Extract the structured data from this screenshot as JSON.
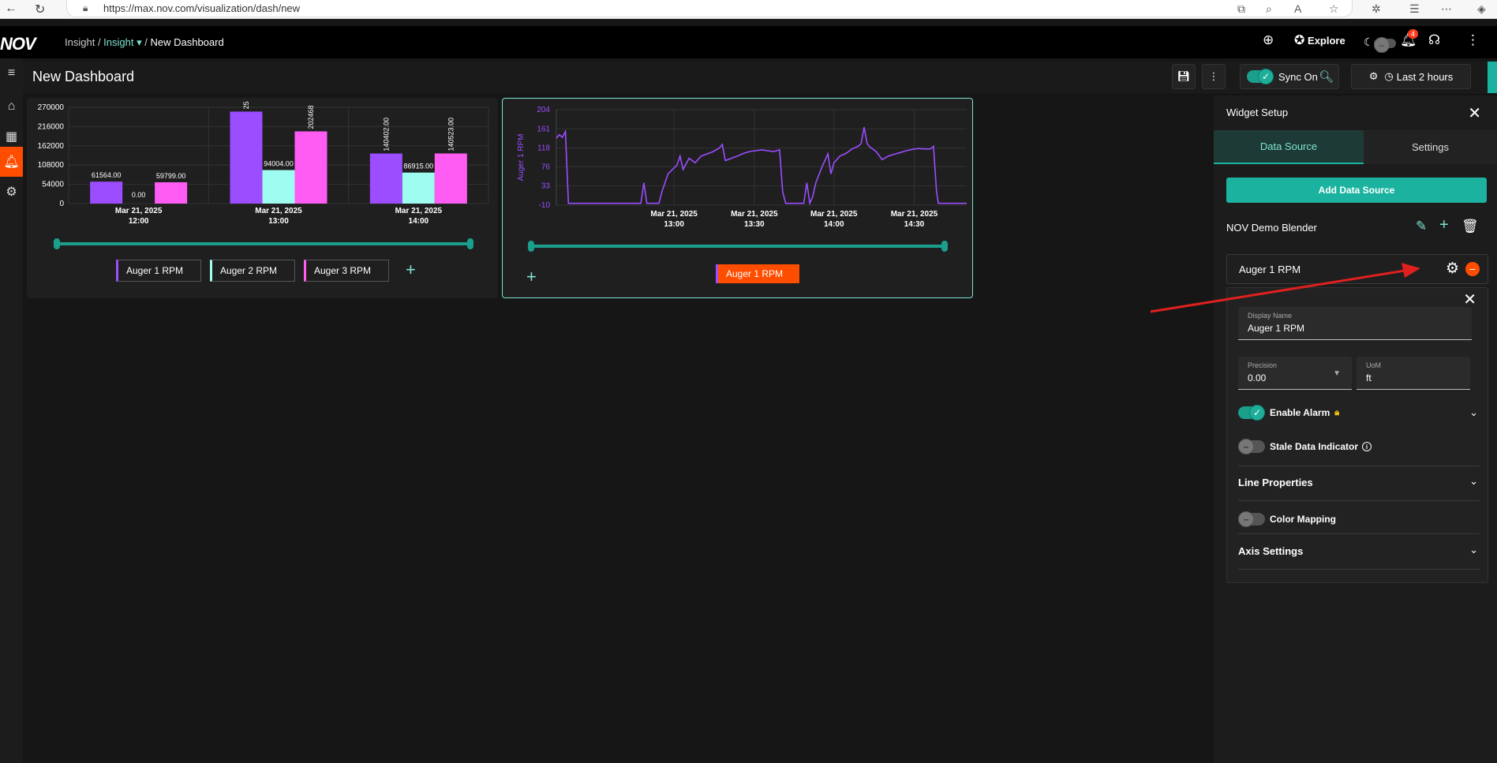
{
  "browser": {
    "url": "https://max.nov.com/visualization/dash/new"
  },
  "header": {
    "logo": "NOV",
    "breadcrumb": {
      "root": "Insight",
      "section": "Insight",
      "page": "New Dashboard"
    },
    "explore_label": "Explore",
    "notification_count": "4"
  },
  "toolbar": {
    "title": "New Dashboard",
    "sync_label": "Sync On",
    "time_range_label": "Last 2 hours"
  },
  "bar_widget": {
    "legend": [
      {
        "label": "Auger 1 RPM",
        "color": "#9b4dff"
      },
      {
        "label": "Auger 2 RPM",
        "color": "#9efcf0"
      },
      {
        "label": "Auger 3 RPM",
        "color": "#ff5cf4"
      }
    ]
  },
  "line_widget": {
    "legend": [
      {
        "label": "Auger 1 RPM",
        "color": "#ff4d00"
      }
    ]
  },
  "chart_data": [
    {
      "type": "bar",
      "categories": [
        "Mar 21, 2025 12:00",
        "Mar 21, 2025 13:00",
        "Mar 21, 2025 14:00"
      ],
      "category_lines": [
        [
          "Mar 21, 2025",
          "12:00"
        ],
        [
          "Mar 21, 2025",
          "13:00"
        ],
        [
          "Mar 21, 2025",
          "14:00"
        ]
      ],
      "y_ticks": [
        "270000",
        "216000",
        "162000",
        "108000",
        "54000",
        "0"
      ],
      "ylim": [
        0,
        270000
      ],
      "series": [
        {
          "name": "Auger 1 RPM",
          "color": "#9b4dff",
          "values": [
            61564,
            258000,
            140402
          ],
          "labels": [
            "61564.00",
            "25",
            "140402.00"
          ]
        },
        {
          "name": "Auger 2 RPM",
          "color": "#9efcf0",
          "values": [
            0,
            94004,
            86915
          ],
          "labels": [
            "0.00",
            "94004.00",
            "86915.00"
          ]
        },
        {
          "name": "Auger 3 RPM",
          "color": "#ff5cf4",
          "values": [
            59799,
            202468,
            140523
          ],
          "labels": [
            "59799.00",
            "202468",
            "140523.00"
          ]
        }
      ],
      "grid": true
    },
    {
      "type": "line",
      "ylabel": "Auger 1 RPM",
      "y_ticks": [
        "204",
        "161",
        "118",
        "76",
        "33",
        "-10"
      ],
      "ylim": [
        -10,
        204
      ],
      "x_ticks": [
        [
          "Mar 21, 2025",
          "13:00"
        ],
        [
          "Mar 21, 2025",
          "13:30"
        ],
        [
          "Mar 21, 2025",
          "14:00"
        ],
        [
          "Mar 21, 2025",
          "14:30"
        ]
      ],
      "xlim_minutes": [
        -20,
        35
      ],
      "series": [
        {
          "name": "Auger 1 RPM",
          "color": "#9b4dff",
          "points": [
            [
              -20,
              140
            ],
            [
              -19.5,
              148
            ],
            [
              -19,
              142
            ],
            [
              -18.5,
              155
            ],
            [
              -18,
              -6
            ],
            [
              -12,
              -6
            ],
            [
              -6,
              -6
            ],
            [
              -5.5,
              40
            ],
            [
              -5,
              -6
            ],
            [
              -3,
              -6
            ],
            [
              -2.5,
              20
            ],
            [
              -1.5,
              60
            ],
            [
              0,
              80
            ],
            [
              0.5,
              100
            ],
            [
              1,
              70
            ],
            [
              2,
              95
            ],
            [
              3,
              85
            ],
            [
              4,
              100
            ],
            [
              5,
              105
            ],
            [
              6,
              110
            ],
            [
              7,
              118
            ],
            [
              7.5,
              126
            ],
            [
              8,
              90
            ],
            [
              9,
              95
            ],
            [
              10,
              100
            ],
            [
              11,
              106
            ],
            [
              12,
              110
            ],
            [
              13,
              112
            ],
            [
              14,
              114
            ],
            [
              15,
              112
            ],
            [
              16,
              110
            ],
            [
              17,
              114
            ],
            [
              17.5,
              20
            ],
            [
              18,
              -6
            ],
            [
              21,
              -6
            ],
            [
              21.5,
              40
            ],
            [
              22,
              -6
            ],
            [
              22.5,
              10
            ],
            [
              23,
              40
            ],
            [
              24,
              75
            ],
            [
              25,
              105
            ],
            [
              25.5,
              60
            ],
            [
              26,
              85
            ],
            [
              27,
              100
            ],
            [
              28,
              106
            ],
            [
              29,
              116
            ],
            [
              30,
              122
            ],
            [
              30.5,
              128
            ],
            [
              31,
              165
            ],
            [
              31.5,
              128
            ],
            [
              32,
              120
            ],
            [
              33,
              110
            ],
            [
              34,
              92
            ],
            [
              35,
              100
            ],
            [
              36,
              104
            ],
            [
              37,
              108
            ],
            [
              38,
              112
            ],
            [
              39,
              115
            ],
            [
              40,
              117
            ],
            [
              41,
              116
            ],
            [
              42,
              116
            ],
            [
              42.5,
              122
            ],
            [
              43,
              20
            ],
            [
              43.3,
              -6
            ],
            [
              48,
              -6
            ]
          ]
        }
      ],
      "grid": true
    }
  ],
  "widget_setup": {
    "title": "Widget Setup",
    "tabs": [
      "Data Source",
      "Settings"
    ],
    "add_data_source_label": "Add Data Source",
    "data_source_name": "NOV Demo Blender",
    "series_label": "Auger 1 RPM",
    "series_settings": {
      "display_name_label": "Display Name",
      "display_name_value": "Auger 1 RPM",
      "precision_label": "Precision",
      "precision_value": "0.00",
      "uom_label": "UoM",
      "uom_value": "ft",
      "enable_alarm_label": "Enable Alarm",
      "stale_label": "Stale Data Indicator",
      "line_properties_label": "Line Properties",
      "color_mapping_label": "Color Mapping",
      "axis_settings_label": "Axis Settings"
    }
  }
}
